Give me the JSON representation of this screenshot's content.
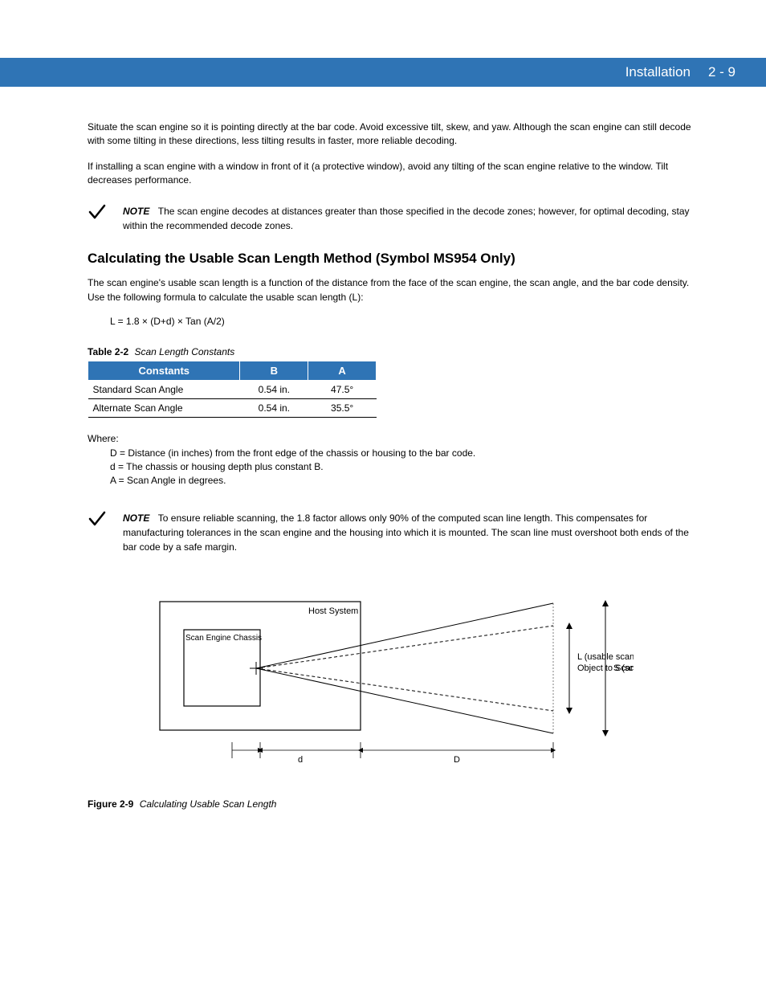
{
  "header": {
    "section": "Installation",
    "page": "2 - 9"
  },
  "para1": "Situate the scan engine so it is pointing directly at the bar code. Avoid excessive tilt, skew, and yaw. Although the scan engine can still decode with some tilting in these directions, less tilting results in faster, more reliable decoding.",
  "para2": "If installing a scan engine with a window in front of it (a protective window), avoid any tilting of the scan engine relative to the window. Tilt decreases performance.",
  "note1_label": "NOTE",
  "note1": "The scan engine decodes at distances greater than those specified in the decode zones; however, for optimal decoding, stay within the recommended decode zones.",
  "subhead": "Calculating the Usable Scan Length Method (Symbol MS954 Only)",
  "para3": "The scan engine's usable scan length is a function of the distance from the face of the scan engine, the scan angle, and the bar code density. Use the following formula to calculate the usable scan length (L):",
  "formula": "L = 1.8 × (D+d) × Tan (A/2)",
  "table_caption_num": "Table 2-2",
  "table_caption_title": "Scan Length Constants",
  "table": {
    "headers": [
      "Constants",
      "B",
      "A"
    ],
    "rows": [
      [
        "Standard Scan Angle",
        "0.54 in.",
        "47.5°"
      ],
      [
        "Alternate Scan Angle",
        "0.54 in.",
        "35.5°"
      ]
    ]
  },
  "where_intro": "Where:",
  "where_lines": [
    "D = Distance (in inches) from the front edge of the chassis or housing to the bar code.",
    "d = The chassis or housing depth plus constant B.",
    "A = Scan Angle in degrees."
  ],
  "note2_label": "NOTE",
  "note2": "To ensure reliable scanning, the 1.8 factor allows only 90% of the computed scan line length. This compensates for manufacturing tolerances in the scan engine and the housing into which it is mounted. The scan line must overshoot both ends of the bar code by a safe margin.",
  "figure": {
    "host_label": "Host System",
    "chassis_label": "Scan Engine Chassis",
    "d_label": "d",
    "D_label": "D",
    "L_label": "L (usable scan length)",
    "S_label": "S (scan length)",
    "obj_label": "Object to Scan"
  },
  "figure_caption_num": "Figure 2-9",
  "figure_caption_title": "Calculating Usable Scan Length"
}
